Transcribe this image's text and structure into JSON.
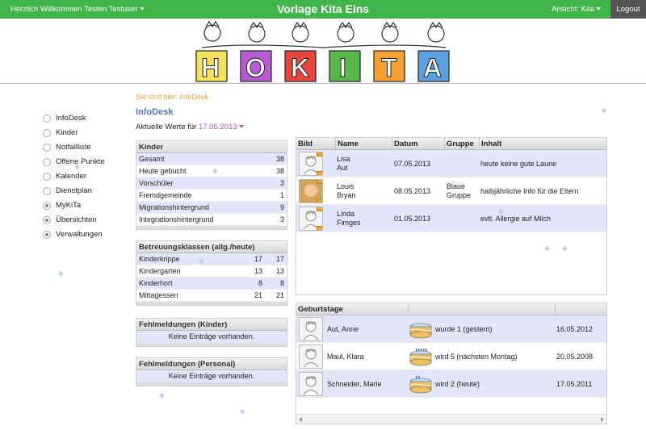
{
  "topbar": {
    "welcome": "Herzlich Willkommen Testen Testuser",
    "title": "Vorlage Kita Eins",
    "view": "Ansicht: Kita",
    "logout": "Logout"
  },
  "banner": {
    "letters": [
      "H",
      "O",
      "K",
      "I",
      "T",
      "A"
    ],
    "colors": {
      "green": "#3fb54a",
      "accent": "#4a78c8",
      "breadcrumb": "#e3a23a",
      "date": "#c050a0",
      "row_alt": "#e3e5fb"
    }
  },
  "breadcrumb": "Sie sind hier: InfoDesk",
  "page_title": "InfoDesk",
  "current": {
    "label": "Aktuelle Werte für",
    "date": "17.05.2013"
  },
  "nav": {
    "items": [
      {
        "label": "InfoDesk",
        "dot": false
      },
      {
        "label": "Kinder",
        "dot": false
      },
      {
        "label": "Notfallliste",
        "dot": false
      },
      {
        "label": "Offene Punkte",
        "dot": false
      },
      {
        "label": "Kalender",
        "dot": false
      },
      {
        "label": "Dienstplan",
        "dot": false
      },
      {
        "label": "MyKiTa",
        "dot": true
      },
      {
        "label": "Übersichten",
        "dot": true
      },
      {
        "label": "Verwaltungen",
        "dot": true
      }
    ]
  },
  "kinder": {
    "title": "Kinder",
    "rows": [
      {
        "label": "Gesamt",
        "value": "38"
      },
      {
        "label": "Heute gebucht",
        "value": "38"
      },
      {
        "label": "Vorschüler",
        "value": "3"
      },
      {
        "label": "Fremdgemeinde",
        "value": "1"
      },
      {
        "label": "Migrationshintergrund",
        "value": "9"
      },
      {
        "label": "Integrationshintergrund",
        "value": "3"
      }
    ]
  },
  "betreuung": {
    "title": "Betreuungsklassen (allg./heute)",
    "rows": [
      {
        "label": "Kinderkrippe",
        "a": "17",
        "b": "17"
      },
      {
        "label": "Kindergarten",
        "a": "13",
        "b": "13"
      },
      {
        "label": "Kinderhort",
        "a": "8",
        "b": "8"
      },
      {
        "label": "Mittagessen",
        "a": "21",
        "b": "21"
      }
    ]
  },
  "fehl_kinder": {
    "title": "Fehlmeldungen (Kinder)",
    "empty": "Keine Einträge vorhanden."
  },
  "fehl_personal": {
    "title": "Fehlmeldungen (Personal)",
    "empty": "Keine Einträge vorhanden."
  },
  "notes": {
    "columns": [
      "Bild",
      "Name",
      "Datum",
      "Gruppe",
      "Inhalt"
    ],
    "rows": [
      {
        "first": "Lisa",
        "last": "Aut",
        "date": "07.05.2013",
        "group1": "",
        "group2": "",
        "content": "heute keine gute Laune",
        "photo": false
      },
      {
        "first": "Louis",
        "last": "Bryan",
        "date": "08.05.2013",
        "group1": "Blaue",
        "group2": "Gruppe",
        "content": "halbjährliche Info für die Eltern",
        "photo": true
      },
      {
        "first": "Linda",
        "last": "Fimges",
        "date": "01.05.2013",
        "group1": "",
        "group2": "",
        "content": "evtl. Allergie auf Milch",
        "photo": false
      }
    ]
  },
  "birthdays": {
    "title": "Geburtstage",
    "rows": [
      {
        "name": "Aut, Anne",
        "text": "wurde 1 (gestern)",
        "date": "16.05.2012",
        "candles": 0
      },
      {
        "name": "Maul, Klara",
        "text": "wird 5 (nächsten Montag)",
        "date": "20.05.2008",
        "candles": 5
      },
      {
        "name": "Schneider, Marie",
        "text": "wird 2 (heute)",
        "date": "17.05.2011",
        "candles": 2
      }
    ]
  }
}
